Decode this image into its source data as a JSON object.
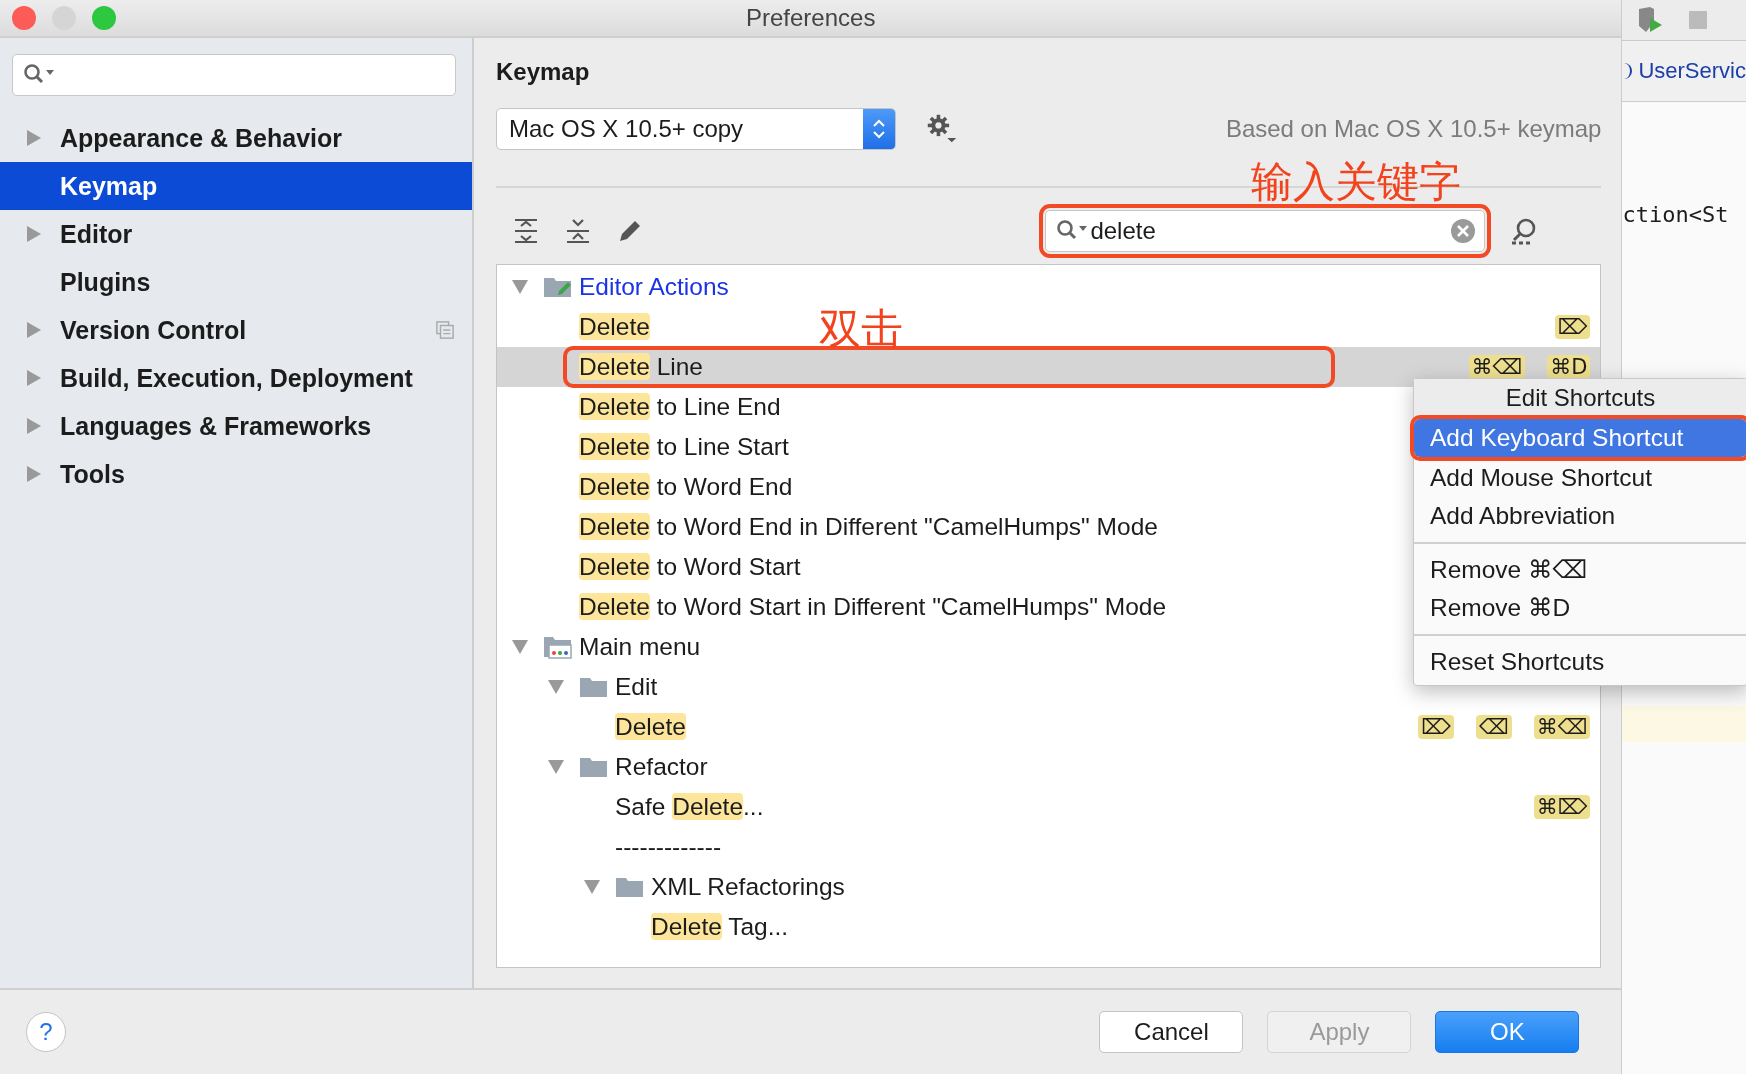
{
  "window": {
    "title": "Preferences"
  },
  "sidebar": {
    "items": [
      {
        "label": "Appearance & Behavior",
        "expandable": true,
        "selected": false,
        "project_icon": false
      },
      {
        "label": "Keymap",
        "expandable": false,
        "selected": true,
        "project_icon": false
      },
      {
        "label": "Editor",
        "expandable": true,
        "selected": false,
        "project_icon": false
      },
      {
        "label": "Plugins",
        "expandable": false,
        "selected": false,
        "project_icon": false
      },
      {
        "label": "Version Control",
        "expandable": true,
        "selected": false,
        "project_icon": true
      },
      {
        "label": "Build, Execution, Deployment",
        "expandable": true,
        "selected": false,
        "project_icon": false
      },
      {
        "label": "Languages & Frameworks",
        "expandable": true,
        "selected": false,
        "project_icon": false
      },
      {
        "label": "Tools",
        "expandable": true,
        "selected": false,
        "project_icon": false
      }
    ]
  },
  "keymap": {
    "title": "Keymap",
    "scheme": "Mac OS X 10.5+ copy",
    "based_on": "Based on Mac OS X 10.5+ keymap",
    "search": {
      "value": "delete",
      "annotated": true,
      "annotation_label": "输入关键字"
    },
    "tree": [
      {
        "kind": "editor-actions",
        "modified": true,
        "expanded": true,
        "label": [
          {
            "text": "Editor Actions",
            "match": false
          }
        ],
        "children": [
          {
            "kind": "action",
            "selected": false,
            "label": [
              {
                "text": "Delete",
                "match": true
              }
            ],
            "shortcuts": [
              "⌦"
            ]
          },
          {
            "kind": "action",
            "selected": true,
            "annotated": true,
            "annotation_label": "双击",
            "label": [
              {
                "text": "Delete",
                "match": true
              },
              {
                "text": " Line",
                "match": false
              }
            ],
            "shortcuts": [
              "⌘⌫",
              "⌘D"
            ]
          },
          {
            "kind": "action",
            "selected": false,
            "label": [
              {
                "text": "Delete",
                "match": true
              },
              {
                "text": " to Line End",
                "match": false
              }
            ]
          },
          {
            "kind": "action",
            "selected": false,
            "label": [
              {
                "text": "Delete",
                "match": true
              },
              {
                "text": " to Line Start",
                "match": false
              }
            ]
          },
          {
            "kind": "action",
            "selected": false,
            "label": [
              {
                "text": "Delete",
                "match": true
              },
              {
                "text": " to Word End",
                "match": false
              }
            ]
          },
          {
            "kind": "action",
            "selected": false,
            "label": [
              {
                "text": "Delete",
                "match": true
              },
              {
                "text": " to Word End in Different \"CamelHumps\" Mode",
                "match": false
              }
            ]
          },
          {
            "kind": "action",
            "selected": false,
            "label": [
              {
                "text": "Delete",
                "match": true
              },
              {
                "text": " to Word Start",
                "match": false
              }
            ]
          },
          {
            "kind": "action",
            "selected": false,
            "label": [
              {
                "text": "Delete",
                "match": true
              },
              {
                "text": " to Word Start in Different \"CamelHumps\" Mode",
                "match": false
              }
            ]
          }
        ]
      },
      {
        "kind": "main-menu",
        "modified": false,
        "expanded": true,
        "label": [
          {
            "text": "Main menu",
            "match": false
          }
        ],
        "children": [
          {
            "kind": "folder",
            "expanded": true,
            "label": [
              {
                "text": "Edit",
                "match": false
              }
            ],
            "children": [
              {
                "kind": "action",
                "selected": false,
                "label": [
                  {
                    "text": "Delete",
                    "match": true
                  }
                ],
                "shortcuts": [
                  "⌦",
                  "⌫",
                  "⌘⌫"
                ]
              }
            ]
          },
          {
            "kind": "folder",
            "expanded": true,
            "label": [
              {
                "text": "Refactor",
                "match": false
              }
            ],
            "children": [
              {
                "kind": "action",
                "selected": false,
                "label": [
                  {
                    "text": "Safe ",
                    "match": false
                  },
                  {
                    "text": "Delete",
                    "match": true
                  },
                  {
                    "text": "...",
                    "match": false
                  }
                ],
                "shortcuts": [
                  "⌘⌦"
                ]
              },
              {
                "kind": "action",
                "selected": false,
                "label": [
                  {
                    "text": "-------------",
                    "match": false
                  }
                ]
              },
              {
                "kind": "folder",
                "expanded": true,
                "label": [
                  {
                    "text": "XML Refactorings",
                    "match": false
                  }
                ],
                "children": [
                  {
                    "kind": "action",
                    "selected": false,
                    "label": [
                      {
                        "text": "Delete",
                        "match": true
                      },
                      {
                        "text": " Tag...",
                        "match": false
                      }
                    ]
                  }
                ]
              }
            ]
          }
        ]
      }
    ]
  },
  "context_menu": {
    "items": [
      {
        "kind": "header",
        "label": "Edit Shortcuts"
      },
      {
        "kind": "item",
        "label": "Add Keyboard Shortcut",
        "selected": true,
        "annotated": true
      },
      {
        "kind": "item",
        "label": "Add Mouse Shortcut",
        "selected": false,
        "annotated": false
      },
      {
        "kind": "item",
        "label": "Add Abbreviation",
        "selected": false,
        "annotated": false
      },
      {
        "kind": "separator"
      },
      {
        "kind": "item",
        "label": "Remove ⌘⌫",
        "selected": false,
        "annotated": false
      },
      {
        "kind": "item",
        "label": "Remove ⌘D",
        "selected": false,
        "annotated": false
      },
      {
        "kind": "separator"
      },
      {
        "kind": "item",
        "label": "Reset Shortcuts",
        "selected": false,
        "annotated": false
      }
    ]
  },
  "buttons": [
    {
      "kind": "help",
      "label": "?"
    },
    {
      "kind": "normal",
      "label": "Cancel",
      "disabled": false
    },
    {
      "kind": "normal",
      "label": "Apply",
      "disabled": true
    },
    {
      "kind": "default",
      "label": "OK",
      "disabled": false
    }
  ],
  "background_ide": {
    "tab": "UserServic",
    "code": "ction<St"
  }
}
